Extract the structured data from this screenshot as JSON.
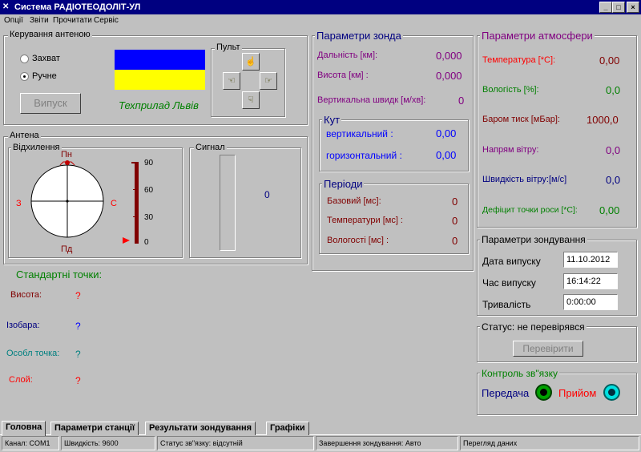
{
  "window": {
    "title": "Система РАДІОТЕОДОЛІТ-УЛ"
  },
  "menu": [
    "Опції",
    "Звіти",
    "Прочитати",
    "Сервіс"
  ],
  "antenna_control": {
    "title": "Керування антеною",
    "radio_capture": "Захват",
    "radio_manual": "Ручне",
    "release_button": "Випуск",
    "brand": "Техприлад Львів",
    "flag_colors": [
      "#0000ff",
      "#ffff00"
    ],
    "remote_title": "Пульт"
  },
  "antenna": {
    "title": "Антена",
    "deviation_title": "Відхилення",
    "signal_title": "Сигнал",
    "north": "Пн",
    "south": "Пд",
    "west": "З",
    "east": "С",
    "scale": [
      "90",
      "60",
      "30",
      "0"
    ],
    "signal_value": "0"
  },
  "standard_points": {
    "title": "Стандартні точки:",
    "rows": [
      {
        "label": "Висота:",
        "value": "?"
      },
      {
        "label": "Ізобара:",
        "value": "?"
      },
      {
        "label": "Особл точка:",
        "value": "?"
      },
      {
        "label": "Слой:",
        "value": "?"
      }
    ]
  },
  "probe": {
    "title": "Параметри зонда",
    "range_label": "Дальність [км]:",
    "range_value": "0,000",
    "height_label": "Висота [км] :",
    "height_value": "0,000",
    "vspeed_label": "Вертикальна швидк [м/хв]:",
    "vspeed_value": "0"
  },
  "angle": {
    "title": "Кут",
    "vertical_label": "вертикальний :",
    "vertical_value": "0,00",
    "horizontal_label": "горизонтальний :",
    "horizontal_value": "0,00"
  },
  "periods": {
    "title": "Періоди",
    "base_label": "Базовий [мс]:",
    "base_value": "0",
    "temp_label": "Температури [мс] :",
    "temp_value": "0",
    "hum_label": "Вологості [мс] :",
    "hum_value": "0"
  },
  "atmosphere": {
    "title": "Параметри атмосфери",
    "temp_label": "Температура [*C]:",
    "temp_value": "0,00",
    "hum_label": "Вологість [%]:",
    "hum_value": "0,0",
    "press_label": "Баром тиск [мБар]:",
    "press_value": "1000,0",
    "wdir_label": "Напрям вітру:",
    "wdir_value": "0,0",
    "wspd_label": "Швидкість вітру:[м/с]",
    "wspd_value": "0,0",
    "dew_label": "Дефіцит точки роси [*C]:",
    "dew_value": "0,00"
  },
  "sounding": {
    "title": "Параметри зондування",
    "date_label": "Дата випуску",
    "date_value": "11.10.2012",
    "time_label": "Час випуску",
    "time_value": "16:14:22",
    "dur_label": "Тривалість",
    "dur_value": "0:00:00"
  },
  "status_box": {
    "text": "Статус: не перевірявся",
    "check_button": "Перевірити"
  },
  "link": {
    "title": "Контроль зв\"язку",
    "tx": "Передача",
    "rx": "Прийом"
  },
  "tabs": [
    "Головна",
    "Параметри станції",
    "Результати зондування",
    "Графіки"
  ],
  "statusbar": {
    "channel": "Канал: COM1",
    "speed": "Швидкість: 9600",
    "link_status": "Статус зв\"язку:  відсутній",
    "end": "Завершення зондування: Авто",
    "view": "Перегляд даних"
  }
}
